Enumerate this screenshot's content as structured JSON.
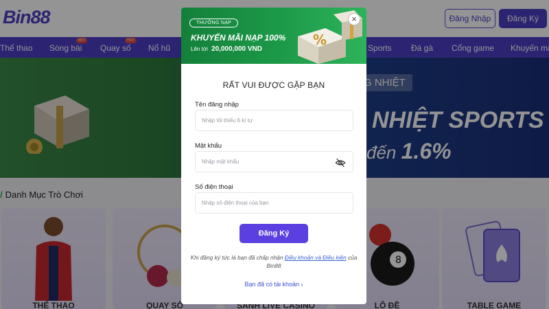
{
  "header": {
    "logo": "Bin88",
    "login_label": "Đăng Nhập",
    "register_label": "Đăng Ký"
  },
  "nav": {
    "items": [
      {
        "label": "Thể thao"
      },
      {
        "label": "Sòng bài",
        "badge": "HOT"
      },
      {
        "label": "Quay số",
        "badge": "HOT"
      },
      {
        "label": "Nổ hũ"
      },
      {
        "label": "Sports"
      },
      {
        "label": "Đá gà"
      },
      {
        "label": "Cổng game"
      },
      {
        "label": "Khuyến mãi"
      }
    ]
  },
  "banner": {
    "tag": "G NHIỆT",
    "title": "NHIỆT SPORTS",
    "sub_prefix": "đến",
    "sub_value": "1.6%"
  },
  "categories": {
    "title": "Danh Mục Trò Chơi",
    "cards": [
      {
        "label": "THỂ THAO"
      },
      {
        "label": "QUAY SỐ"
      },
      {
        "label": "SẢNH LIVE CASINO"
      },
      {
        "label": "LÔ ĐỀ"
      },
      {
        "label": "TABLE GAME"
      }
    ]
  },
  "modal": {
    "promo": {
      "pill": "THƯỞNG NẠP",
      "title": "KHUYẾN MÃI NẠP 100%",
      "sub_prefix": "Lên tới",
      "sub_amount": "20,000,000 VND"
    },
    "close_symbol": "×",
    "heading": "RẤT VUI ĐƯỢC GẶP BẠN",
    "fields": {
      "username": {
        "label": "Tên đăng nhập",
        "placeholder": "Nhập tối thiểu 6 kí tự"
      },
      "password": {
        "label": "Mật khẩu",
        "placeholder": "Nhập mật khẩu",
        "icon": "eye-off-icon"
      },
      "phone": {
        "label": "Số điện thoại",
        "placeholder": "Nhập số điện thoại của bạn"
      }
    },
    "submit_label": "Đăng Ký",
    "terms_prefix": "Khi đăng ký tức là bạn đã chấp nhận",
    "terms_link": "Điều khoản và Điều kiện",
    "terms_suffix": "của Bin88",
    "have_account": "Bạn đã có tài khoản"
  },
  "colors": {
    "brand": "#4d3fc7",
    "primary_button": "#5b3fe0",
    "promo_green": "#1d9a49",
    "link": "#3b63d6"
  }
}
